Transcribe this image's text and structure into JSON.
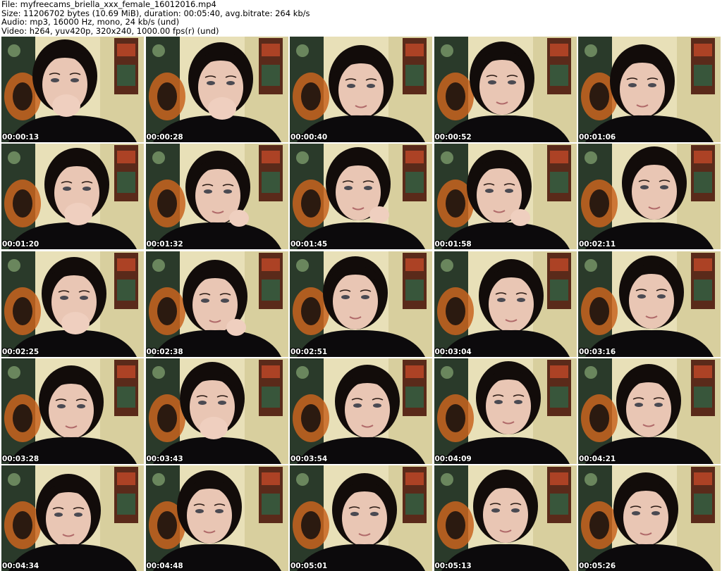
{
  "header": {
    "file": "File: myfreecams_briella_xxx_female_16012016.mp4",
    "size": "Size: 11206702 bytes (10.69 MiB), duration: 00:05:40, avg.bitrate: 264 kb/s",
    "audio": "Audio: mp3, 16000 Hz, mono, 24 kb/s (und)",
    "video": "Video: h264, yuv420p, 320x240, 1000.00 fps(r) (und)"
  },
  "thumbnails": [
    {
      "timestamp": "00:00:13"
    },
    {
      "timestamp": "00:00:28"
    },
    {
      "timestamp": "00:00:40"
    },
    {
      "timestamp": "00:00:52"
    },
    {
      "timestamp": "00:01:06"
    },
    {
      "timestamp": "00:01:20"
    },
    {
      "timestamp": "00:01:32"
    },
    {
      "timestamp": "00:01:45"
    },
    {
      "timestamp": "00:01:58"
    },
    {
      "timestamp": "00:02:11"
    },
    {
      "timestamp": "00:02:25"
    },
    {
      "timestamp": "00:02:38"
    },
    {
      "timestamp": "00:02:51"
    },
    {
      "timestamp": "00:03:04"
    },
    {
      "timestamp": "00:03:16"
    },
    {
      "timestamp": "00:03:28"
    },
    {
      "timestamp": "00:03:43"
    },
    {
      "timestamp": "00:03:54"
    },
    {
      "timestamp": "00:04:09"
    },
    {
      "timestamp": "00:04:21"
    },
    {
      "timestamp": "00:04:34"
    },
    {
      "timestamp": "00:04:48"
    },
    {
      "timestamp": "00:05:01"
    },
    {
      "timestamp": "00:05:13"
    },
    {
      "timestamp": "00:05:26"
    }
  ],
  "colors": {
    "background": "#ffffff",
    "wall": "#e8e0b8",
    "tapestry": "#2a3a2a",
    "tapestry_accent": "#c8641e",
    "hair": "#120c0a",
    "skin": "#e9c6b4",
    "clothing": "#0c0a0c"
  }
}
